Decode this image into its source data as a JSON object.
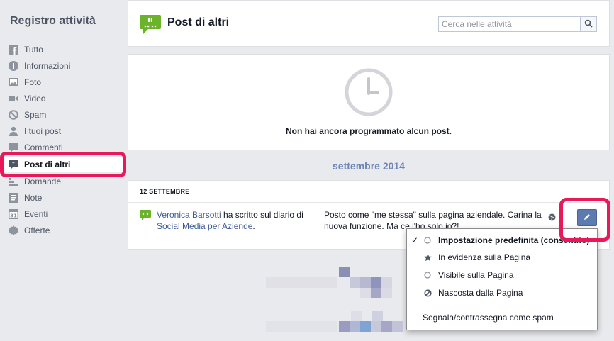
{
  "sidebar": {
    "title": "Registro attività",
    "items": [
      {
        "label": "Tutto",
        "icon": "facebook-icon"
      },
      {
        "label": "Informazioni",
        "icon": "info-icon"
      },
      {
        "label": "Foto",
        "icon": "photo-icon"
      },
      {
        "label": "Video",
        "icon": "video-icon"
      },
      {
        "label": "Spam",
        "icon": "spam-icon"
      },
      {
        "label": "I tuoi post",
        "icon": "person-icon"
      },
      {
        "label": "Commenti",
        "icon": "comment-icon"
      },
      {
        "label": "Post di altri",
        "icon": "post-bubble-icon",
        "active": true
      },
      {
        "label": "Domande",
        "icon": "question-icon"
      },
      {
        "label": "Note",
        "icon": "note-icon"
      },
      {
        "label": "Eventi",
        "icon": "calendar-icon"
      },
      {
        "label": "Offerte",
        "icon": "offer-icon"
      }
    ]
  },
  "header": {
    "title": "Post di altri",
    "search_placeholder": "Cerca nelle attività"
  },
  "scheduled": {
    "empty_text": "Non hai ancora programmato alcun post."
  },
  "timeline": {
    "month": "settembre 2014",
    "date": "12 SETTEMBRE",
    "entry": {
      "author": "Veronica Barsotti",
      "action": " ha scritto sul diario di ",
      "target": "Social Media per Aziende",
      "suffix": ".",
      "post_line1": "Posto come \"me stessa\" sulla pagina aziendale. Carina la",
      "post_line2": "nuova funzione. Ma ce l'ho solo io?!"
    }
  },
  "dropdown": {
    "items": [
      {
        "label": "Impostazione predefinita (consentito)",
        "checked": true,
        "mark": "circle"
      },
      {
        "label": "In evidenza sulla Pagina",
        "checked": false,
        "mark": "star"
      },
      {
        "label": "Visibile sulla Pagina",
        "checked": false,
        "mark": "circle"
      },
      {
        "label": "Nascosta dalla Pagina",
        "checked": false,
        "mark": "blocked"
      }
    ],
    "spam_label": "Segnala/contrassegna come spam"
  },
  "colors": {
    "highlight": "#e8195a",
    "link": "#3b5998",
    "month": "#6d84b4",
    "edit_button": "#5b7bb1",
    "header_icon": "#6bb42a"
  }
}
